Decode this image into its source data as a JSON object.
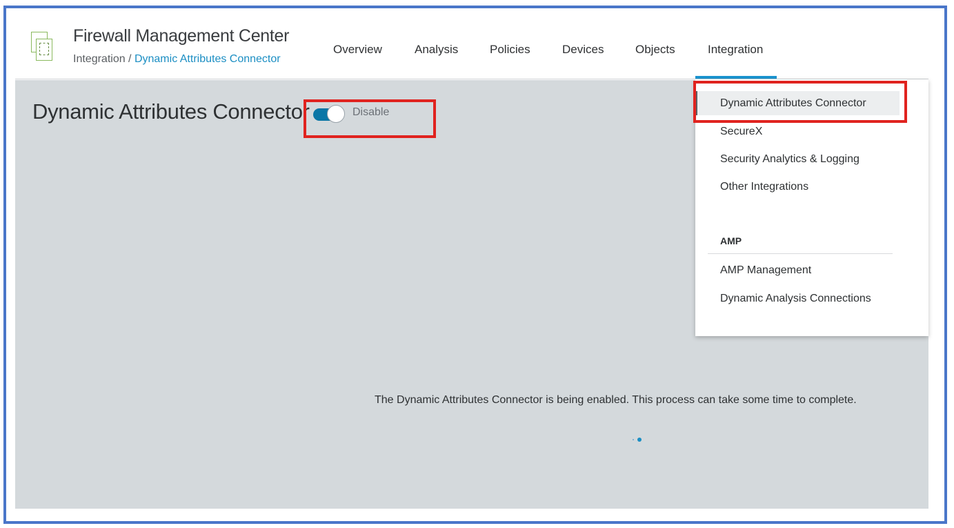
{
  "app": {
    "title": "Firewall Management Center",
    "breadcrumb": {
      "parent": "Integration",
      "separator": " / ",
      "current": "Dynamic Attributes Connector"
    }
  },
  "nav": {
    "items": [
      {
        "label": "Overview"
      },
      {
        "label": "Analysis"
      },
      {
        "label": "Policies"
      },
      {
        "label": "Devices"
      },
      {
        "label": "Objects"
      },
      {
        "label": "Integration"
      }
    ],
    "active": "Integration"
  },
  "page": {
    "title": "Dynamic Attributes Connector",
    "toggle_label": "Disable",
    "toggle_on": true,
    "status_message": "The Dynamic Attributes Connector is being enabled. This process can take some time to complete."
  },
  "dropdown": {
    "items": [
      {
        "label": "Dynamic Attributes Connector"
      },
      {
        "label": "SecureX"
      },
      {
        "label": "Security Analytics & Logging"
      },
      {
        "label": "Other Integrations"
      }
    ],
    "section_title": "AMP",
    "section_items": [
      {
        "label": "AMP Management"
      },
      {
        "label": "Dynamic Analysis Connections"
      }
    ]
  },
  "colors": {
    "accent": "#1b95d1",
    "link": "#1b8ec3",
    "toggle_track": "#0b76a6",
    "content_bg": "#d4d9dc",
    "highlight": "#e0231f",
    "frame": "#4a76c9"
  },
  "icons": {
    "logo": "fmc-logo-icon"
  }
}
